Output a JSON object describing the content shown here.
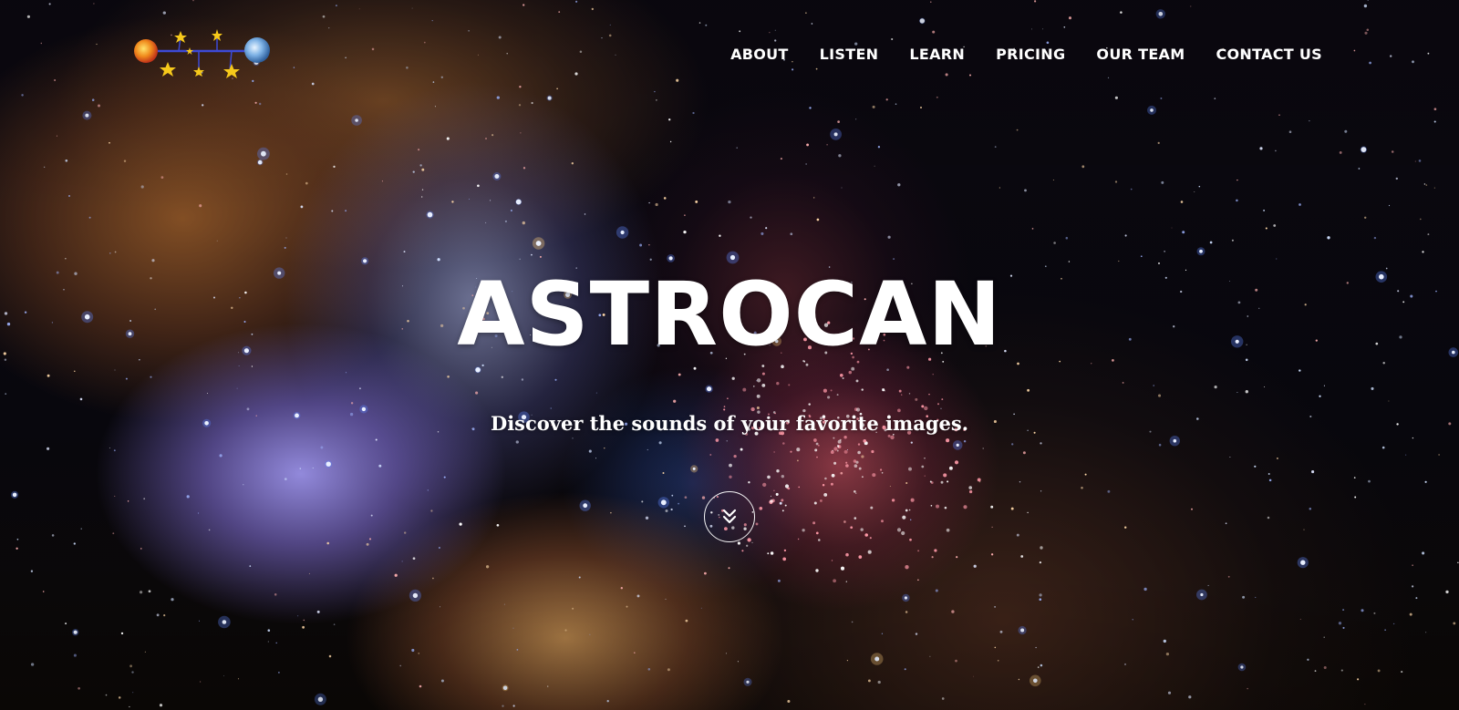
{
  "brand": {
    "logo_icon": "planets-constellation-logo"
  },
  "nav": {
    "items": [
      {
        "label": "ABOUT"
      },
      {
        "label": "LISTEN"
      },
      {
        "label": "LEARN"
      },
      {
        "label": "PRICING"
      },
      {
        "label": "OUR TEAM"
      },
      {
        "label": "CONTACT US"
      }
    ]
  },
  "hero": {
    "title": "ASTROCAN",
    "subtitle": "Discover the sounds of your favorite images.",
    "scroll_icon": "double-chevron-down-icon"
  },
  "colors": {
    "text": "#ffffff",
    "background": "#07060c",
    "nebula_purple": "#a9a0ff",
    "nebula_brown": "#96582a"
  }
}
